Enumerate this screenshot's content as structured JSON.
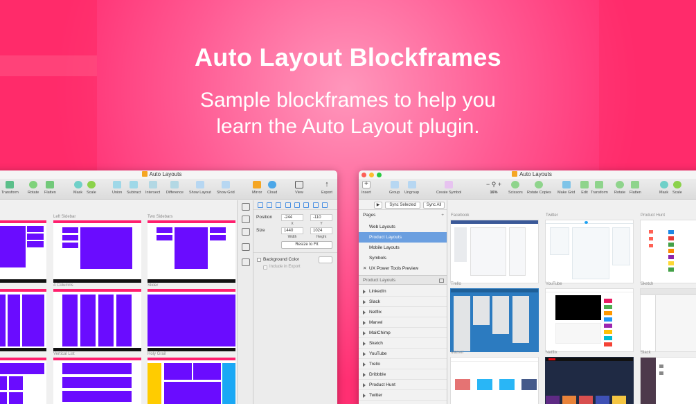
{
  "hero": {
    "title": "Auto Layout Blockframes",
    "subtitle_line1": "Sample blockframes to help you",
    "subtitle_line2": "learn the Auto Layout plugin."
  },
  "colors": {
    "accent_pink": "#ff1f6e",
    "block_purple": "#6a0cff",
    "selection_blue": "#6b9fe0"
  },
  "left_window": {
    "title": "Auto Layouts",
    "toolbar": [
      "Transform",
      "Rotate",
      "Flatten",
      "Mask",
      "Scale",
      "Union",
      "Subtract",
      "Intersect",
      "Difference",
      "Show Layout",
      "Show Grid",
      "Mirror",
      "Cloud",
      "View",
      "Export"
    ],
    "frame_labels": [
      "Left Sidebar",
      "Two Sidebars",
      "4 Columns",
      "Slider",
      "Vertical List",
      "Holy Grail"
    ],
    "inspector": {
      "position_label": "Position",
      "x": "-244",
      "y": "-110",
      "x_label": "X",
      "y_label": "Y",
      "size_label": "Size",
      "width": "1440",
      "height": "1024",
      "width_label": "Width",
      "height_label": "Height",
      "resize_button": "Resize to Fit",
      "background_color": "Background Color",
      "include_export": "Include in Export"
    }
  },
  "right_window": {
    "title": "Auto Layouts",
    "toolbar": [
      "Insert",
      "Group",
      "Ungroup",
      "Create Symbol",
      "16%",
      "Scissors",
      "Rotate Copies",
      "Make Grid",
      "Edit",
      "Transform",
      "Rotate",
      "Flatten",
      "Mask",
      "Scale"
    ],
    "sidebar": {
      "sync_selected": "Sync Selected",
      "sync_all": "Sync All",
      "pages_header": "Pages",
      "pages": [
        "Web Layouts",
        "Product Layouts",
        "Mobile Layouts",
        "Symbols",
        "UX Power Tools Preview"
      ],
      "selected_page": "Product Layouts",
      "layers_header": "Product Layouts",
      "layers": [
        "LinkedIn",
        "Slack",
        "Netflix",
        "Marvel",
        "MailChimp",
        "Sketch",
        "YouTube",
        "Trello",
        "Dribbble",
        "Product Hunt",
        "Twitter"
      ]
    },
    "canvas_labels": [
      "Facebook",
      "Twitter",
      "Product Hunt",
      "Trello",
      "YouTube",
      "Sketch",
      "Marvel",
      "Netflix",
      "Slack"
    ]
  }
}
